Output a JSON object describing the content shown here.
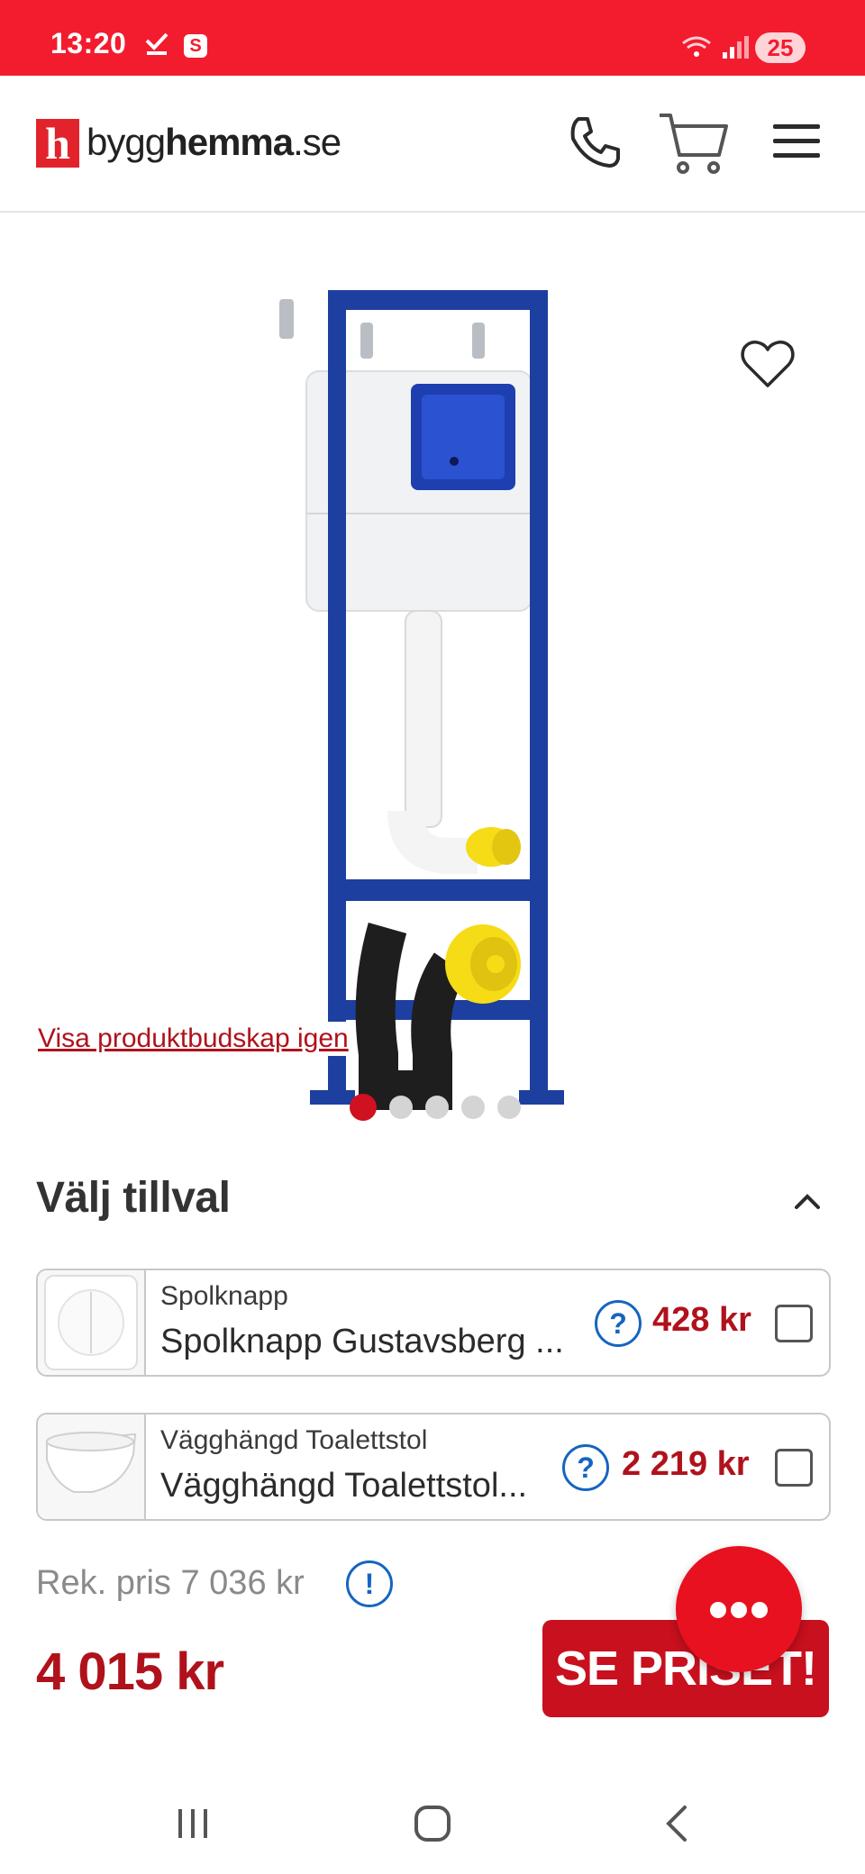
{
  "status_bar": {
    "time": "13:20",
    "notification_app": "S",
    "battery": "25",
    "icons": [
      "check-icon",
      "wifi-icon",
      "signal-icon"
    ]
  },
  "header": {
    "logo_letter": "h",
    "logo_prefix": "bygg",
    "logo_bold": "hemma",
    "logo_suffix": ".se",
    "icons": [
      "phone-icon",
      "cart-icon",
      "menu-icon"
    ]
  },
  "gallery": {
    "message_link": "Visa produktbudskap igen",
    "image_count": 5,
    "active_index": 0
  },
  "addons": {
    "title": "Välj tillval",
    "items": [
      {
        "category": "Spolknapp",
        "name": "Spolknapp Gustavsberg ...",
        "price": "428 kr",
        "checked": false
      },
      {
        "category": "Vägghängd Toalettstol",
        "name": "Vägghängd Toalettstol...",
        "price": "2 219 kr",
        "checked": false
      }
    ]
  },
  "pricing": {
    "rek_label": "Rek. pris 7 036 kr",
    "price": "4 015 kr",
    "cta_label": "SE PRISET!"
  },
  "colors": {
    "brand_red": "#f31b2e",
    "price_red": "#b0121c",
    "help_blue": "#1565c0"
  }
}
